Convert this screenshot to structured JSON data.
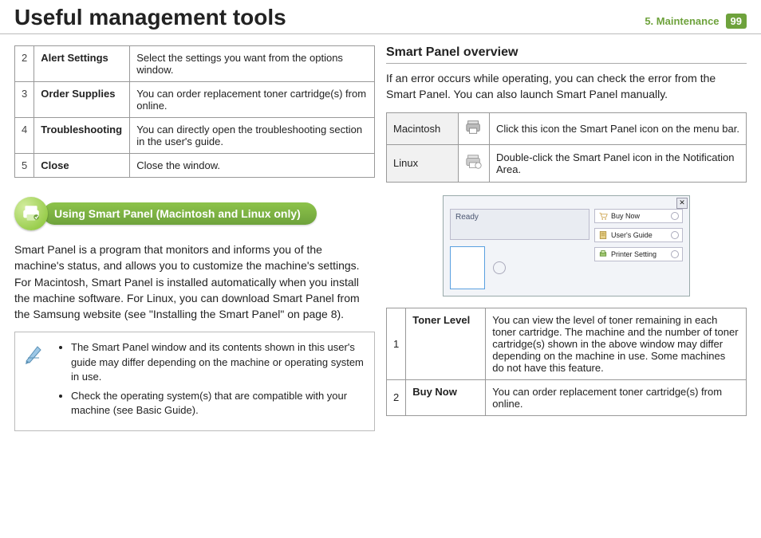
{
  "header": {
    "title": "Useful management tools",
    "chapter": "5.  Maintenance",
    "page": "99"
  },
  "left": {
    "table1": [
      {
        "n": "2",
        "term": "Alert Settings",
        "desc": "Select the settings you want from the options window."
      },
      {
        "n": "3",
        "term": "Order Supplies",
        "desc": "You can order replacement toner cartridge(s) from online."
      },
      {
        "n": "4",
        "term": "Troubleshooting",
        "desc": "You can directly open the troubleshooting section in the user's guide."
      },
      {
        "n": "5",
        "term": "Close",
        "desc": "Close the window."
      }
    ],
    "section_title": "Using Smart Panel (Macintosh and Linux only)",
    "para1": "Smart Panel is a program that monitors and informs you of the machine's status, and allows you to customize the machine's settings. For Macintosh, Smart Panel is installed automatically when you install the machine software. For Linux, you can download Smart Panel from the Samsung website (see \"Installing the Smart Panel\" on page 8).",
    "notes": [
      "The Smart Panel window and its contents shown in this user's guide may differ depending on the machine or operating system in use.",
      "Check the operating system(s) that are compatible with your machine (see Basic Guide)."
    ]
  },
  "right": {
    "heading": "Smart Panel overview",
    "para": "If an error occurs while operating, you can check the error from the Smart Panel. You can also launch Smart Panel manually.",
    "os": [
      {
        "name": "Macintosh",
        "desc": "Click this icon the Smart Panel icon on the menu bar."
      },
      {
        "name": "Linux",
        "desc": "Double-click the Smart Panel icon in the Notification Area."
      }
    ],
    "panel": {
      "ready": "Ready",
      "buttons": [
        "Buy Now",
        "User's Guide",
        "Printer Setting"
      ]
    },
    "sp": [
      {
        "n": "1",
        "term": "Toner Level",
        "desc": "You can view the level of toner remaining in each toner cartridge. The machine and the number of toner cartridge(s) shown in the above window may differ depending on the machine in use. Some machines do not have this feature."
      },
      {
        "n": "2",
        "term": "Buy Now",
        "desc": "You can order replacement toner cartridge(s) from online."
      }
    ]
  }
}
